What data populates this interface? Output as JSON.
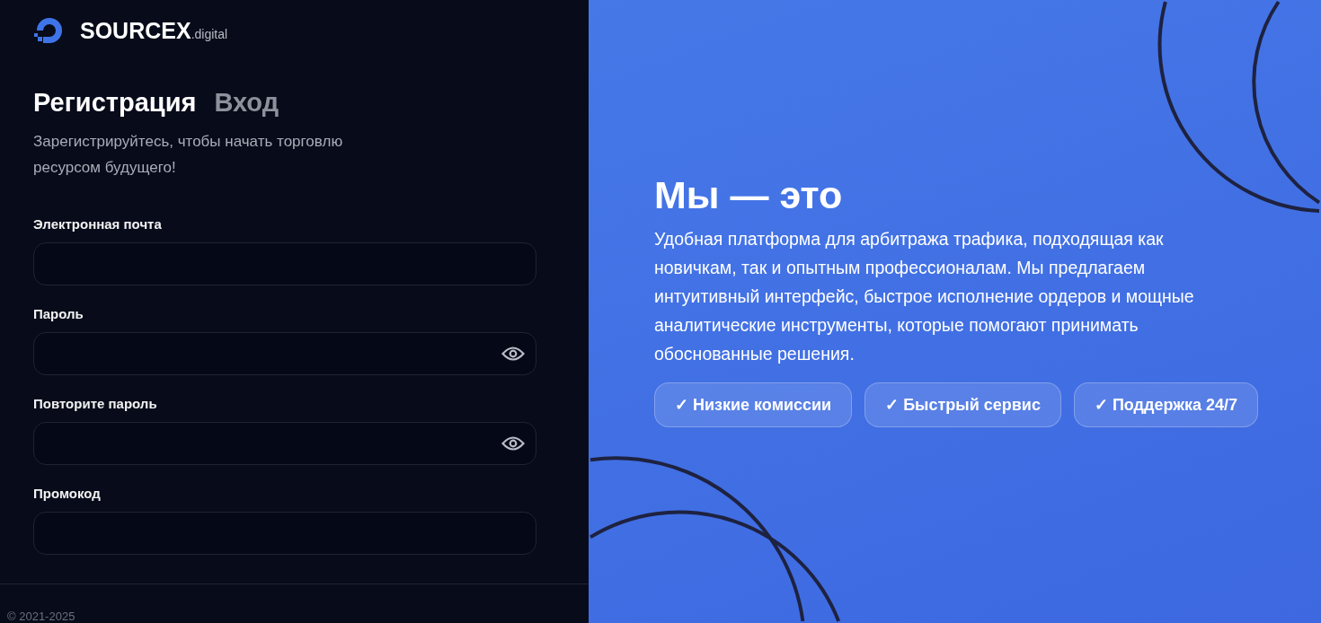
{
  "brand": {
    "name": "SOURCEX",
    "suffix": ".digital"
  },
  "tabs": [
    {
      "label": "Регистрация",
      "selected": true
    },
    {
      "label": "Вход",
      "selected": false
    }
  ],
  "subtitle": "Зарегистрируйтесь, чтобы начать торговлю ресурсом будущего!",
  "fields": [
    {
      "label": "Электронная почта",
      "kind": "text"
    },
    {
      "label": "Пароль",
      "kind": "password"
    },
    {
      "label": "Повторите пароль",
      "kind": "password"
    },
    {
      "label": "Промокод",
      "kind": "text"
    }
  ],
  "footer": "© 2021-2025",
  "promo": {
    "heading": "Мы — это",
    "text": "Удобная платформа для арбитража трафика, подходящая как новичкам, так и опытным профессионалам. Мы предлагаем интуитивный интерфейс, быстрое исполнение ордеров и мощные аналитические инструменты, которые помогают принимать обоснованные решения.",
    "features": [
      "✓ Низкие комиссии",
      "✓ Быстрый сервис",
      "✓ Поддержка 24/7"
    ]
  }
}
